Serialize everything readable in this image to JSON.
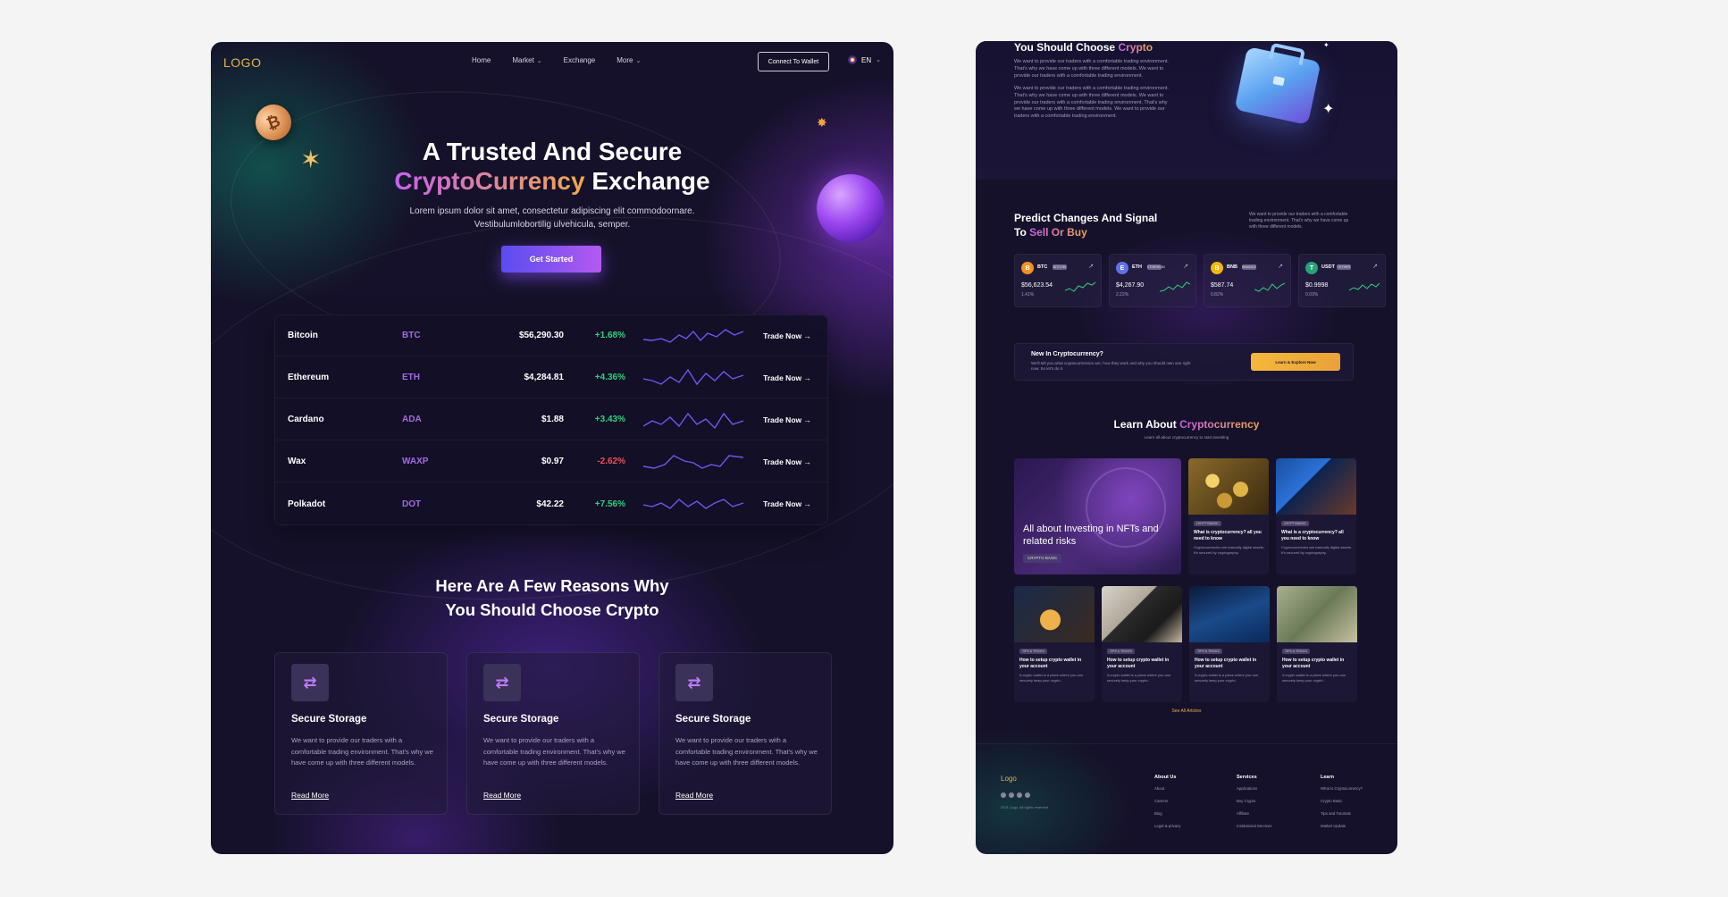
{
  "left": {
    "nav": {
      "logo": "LOGO",
      "links": [
        "Home",
        "Market",
        "Exchange",
        "More"
      ],
      "wallet_button": "Connect To Wallet",
      "language": "EN"
    },
    "hero": {
      "title_line1": "A Trusted And Secure",
      "title_highlight": "CryptoCurrency",
      "title_rest": "Exchange",
      "subtitle_line1": "Lorem ipsum dolor sit amet, consectetur adipiscing elit commodoornare.",
      "subtitle_line2": "Vestibulumlobortilig ulvehicula, semper.",
      "cta": "Get Started"
    },
    "ticker": [
      {
        "name": "Bitcoin",
        "symbol": "BTC",
        "price": "$56,290.30",
        "change": "+1.68%",
        "up": true,
        "trade": "Trade Now"
      },
      {
        "name": "Ethereum",
        "symbol": "ETH",
        "price": "$4,284.81",
        "change": "+4.36%",
        "up": true,
        "trade": "Trade Now"
      },
      {
        "name": "Cardano",
        "symbol": "ADA",
        "price": "$1.88",
        "change": "+3.43%",
        "up": true,
        "trade": "Trade Now"
      },
      {
        "name": "Wax",
        "symbol": "WAXP",
        "price": "$0.97",
        "change": "-2.62%",
        "up": false,
        "trade": "Trade Now"
      },
      {
        "name": "Polkadot",
        "symbol": "DOT",
        "price": "$42.22",
        "change": "+7.56%",
        "up": true,
        "trade": "Trade Now"
      }
    ],
    "reasons": {
      "title_line1": "Here Are A Few Reasons Why",
      "title_line2": "You Should Choose Crypto",
      "cards": [
        {
          "title": "Secure Storage",
          "desc": "We want to provide our traders with a comfortable trading environment. That's why we have come up with three different models.",
          "link": "Read More"
        },
        {
          "title": "Secure Storage",
          "desc": "We want to provide our traders with a comfortable trading environment. That's why we have come up with three different models.",
          "link": "Read More"
        },
        {
          "title": "Secure Storage",
          "desc": "We want to provide our traders with a comfortable trading environment. That's why we have come up with three different models.",
          "link": "Read More"
        }
      ]
    }
  },
  "right": {
    "choose": {
      "title": "You Should Choose",
      "highlight": "Crypto",
      "para1": "We want to provide our traders with a comfortable trading environment. That's why we have come up with three different models. We want to provide our traders with a comfortable trading environment.",
      "para2": "We want to provide our traders with a comfortable trading environment. That's why we have come up with three different models. We want to provide our traders with a comfortable trading environment. That's why we have come up with three different models. We want to provide our traders with a comfortable trading environment."
    },
    "predict": {
      "title_line1": "Predict Changes And Signal",
      "title_prefix": "To",
      "highlight": "Sell Or Buy",
      "desc": "We want to provide our traders with a comfortable trading environment. That's why we have come up with three different models."
    },
    "mini_cards": [
      {
        "symbol": "BTC",
        "badge": "BITCOIN",
        "price": "$56,623.54",
        "change": "1.41%",
        "icon": "B",
        "color": "#f7931a"
      },
      {
        "symbol": "ETH",
        "badge": "ETHEREUM",
        "price": "$4,267.90",
        "change": "2.22%",
        "icon": "E",
        "color": "#6270e8"
      },
      {
        "symbol": "BNB",
        "badge": "BINANCE",
        "price": "$587.74",
        "change": "0.82%",
        "icon": "B",
        "color": "#f0b90b"
      },
      {
        "symbol": "USDT",
        "badge": "TETHER",
        "price": "$0.9998",
        "change": "0.03%",
        "icon": "T",
        "color": "#26a17b"
      }
    ],
    "new_box": {
      "title": "New In Cryptocurrency?",
      "desc": "We'll tell you what cryptocurrencies are, how they work and why you should own one right now. So let's do it.",
      "button": "Learn & Explore Now"
    },
    "learn": {
      "title": "Learn About",
      "highlight": "Cryptocurrency",
      "subtitle": "Learn all about cryptocurrency to start investing",
      "big_card": {
        "title": "All about Investing in NFTs and related risks",
        "badge": "CRYPTO BASIC"
      },
      "top_cards": [
        {
          "tag": "CRYPTOBASIC",
          "title": "What is cryptocurrency? all you need to know",
          "desc": "Cryptocurrencies are basically digital assets. It's secured by cryptography."
        },
        {
          "tag": "CRYPTOBASIC",
          "title": "What is a cryptocurrency? all you need to know",
          "desc": "Cryptocurrencies are basically digital assets. It's secured by cryptography."
        }
      ],
      "bottom_cards": [
        {
          "tag": "TIPS & TRICKS",
          "title": "How to setup crypto wallet in your account",
          "desc": "A crypto wallet is a place where you can securely keep your crypto."
        },
        {
          "tag": "TIPS & TRICKS",
          "title": "How to setup crypto wallet in your account",
          "desc": "A crypto wallet is a place where you can securely keep your crypto."
        },
        {
          "tag": "TIPS & TRICKS",
          "title": "How to setup crypto wallet in your account",
          "desc": "A crypto wallet is a place where you can securely keep your crypto."
        },
        {
          "tag": "TIPS & TRICKS",
          "title": "How to setup crypto wallet in your account",
          "desc": "A crypto wallet is a place where you can securely keep your crypto."
        }
      ],
      "see_all": "See All Articles"
    },
    "footer": {
      "logo": "Logo",
      "copyright": "2021 Logo. All rights reserved",
      "columns": [
        {
          "heading": "About Us",
          "items": [
            "About",
            "Careers",
            "Blog",
            "Legal & privacy"
          ]
        },
        {
          "heading": "Services",
          "items": [
            "Applications",
            "Buy Crypto",
            "Affiliate",
            "Institutional Services"
          ]
        },
        {
          "heading": "Learn",
          "items": [
            "What is Cryptocurrency?",
            "Crypto Basic",
            "Tips and Tutorials",
            "Market Update"
          ]
        }
      ]
    }
  }
}
